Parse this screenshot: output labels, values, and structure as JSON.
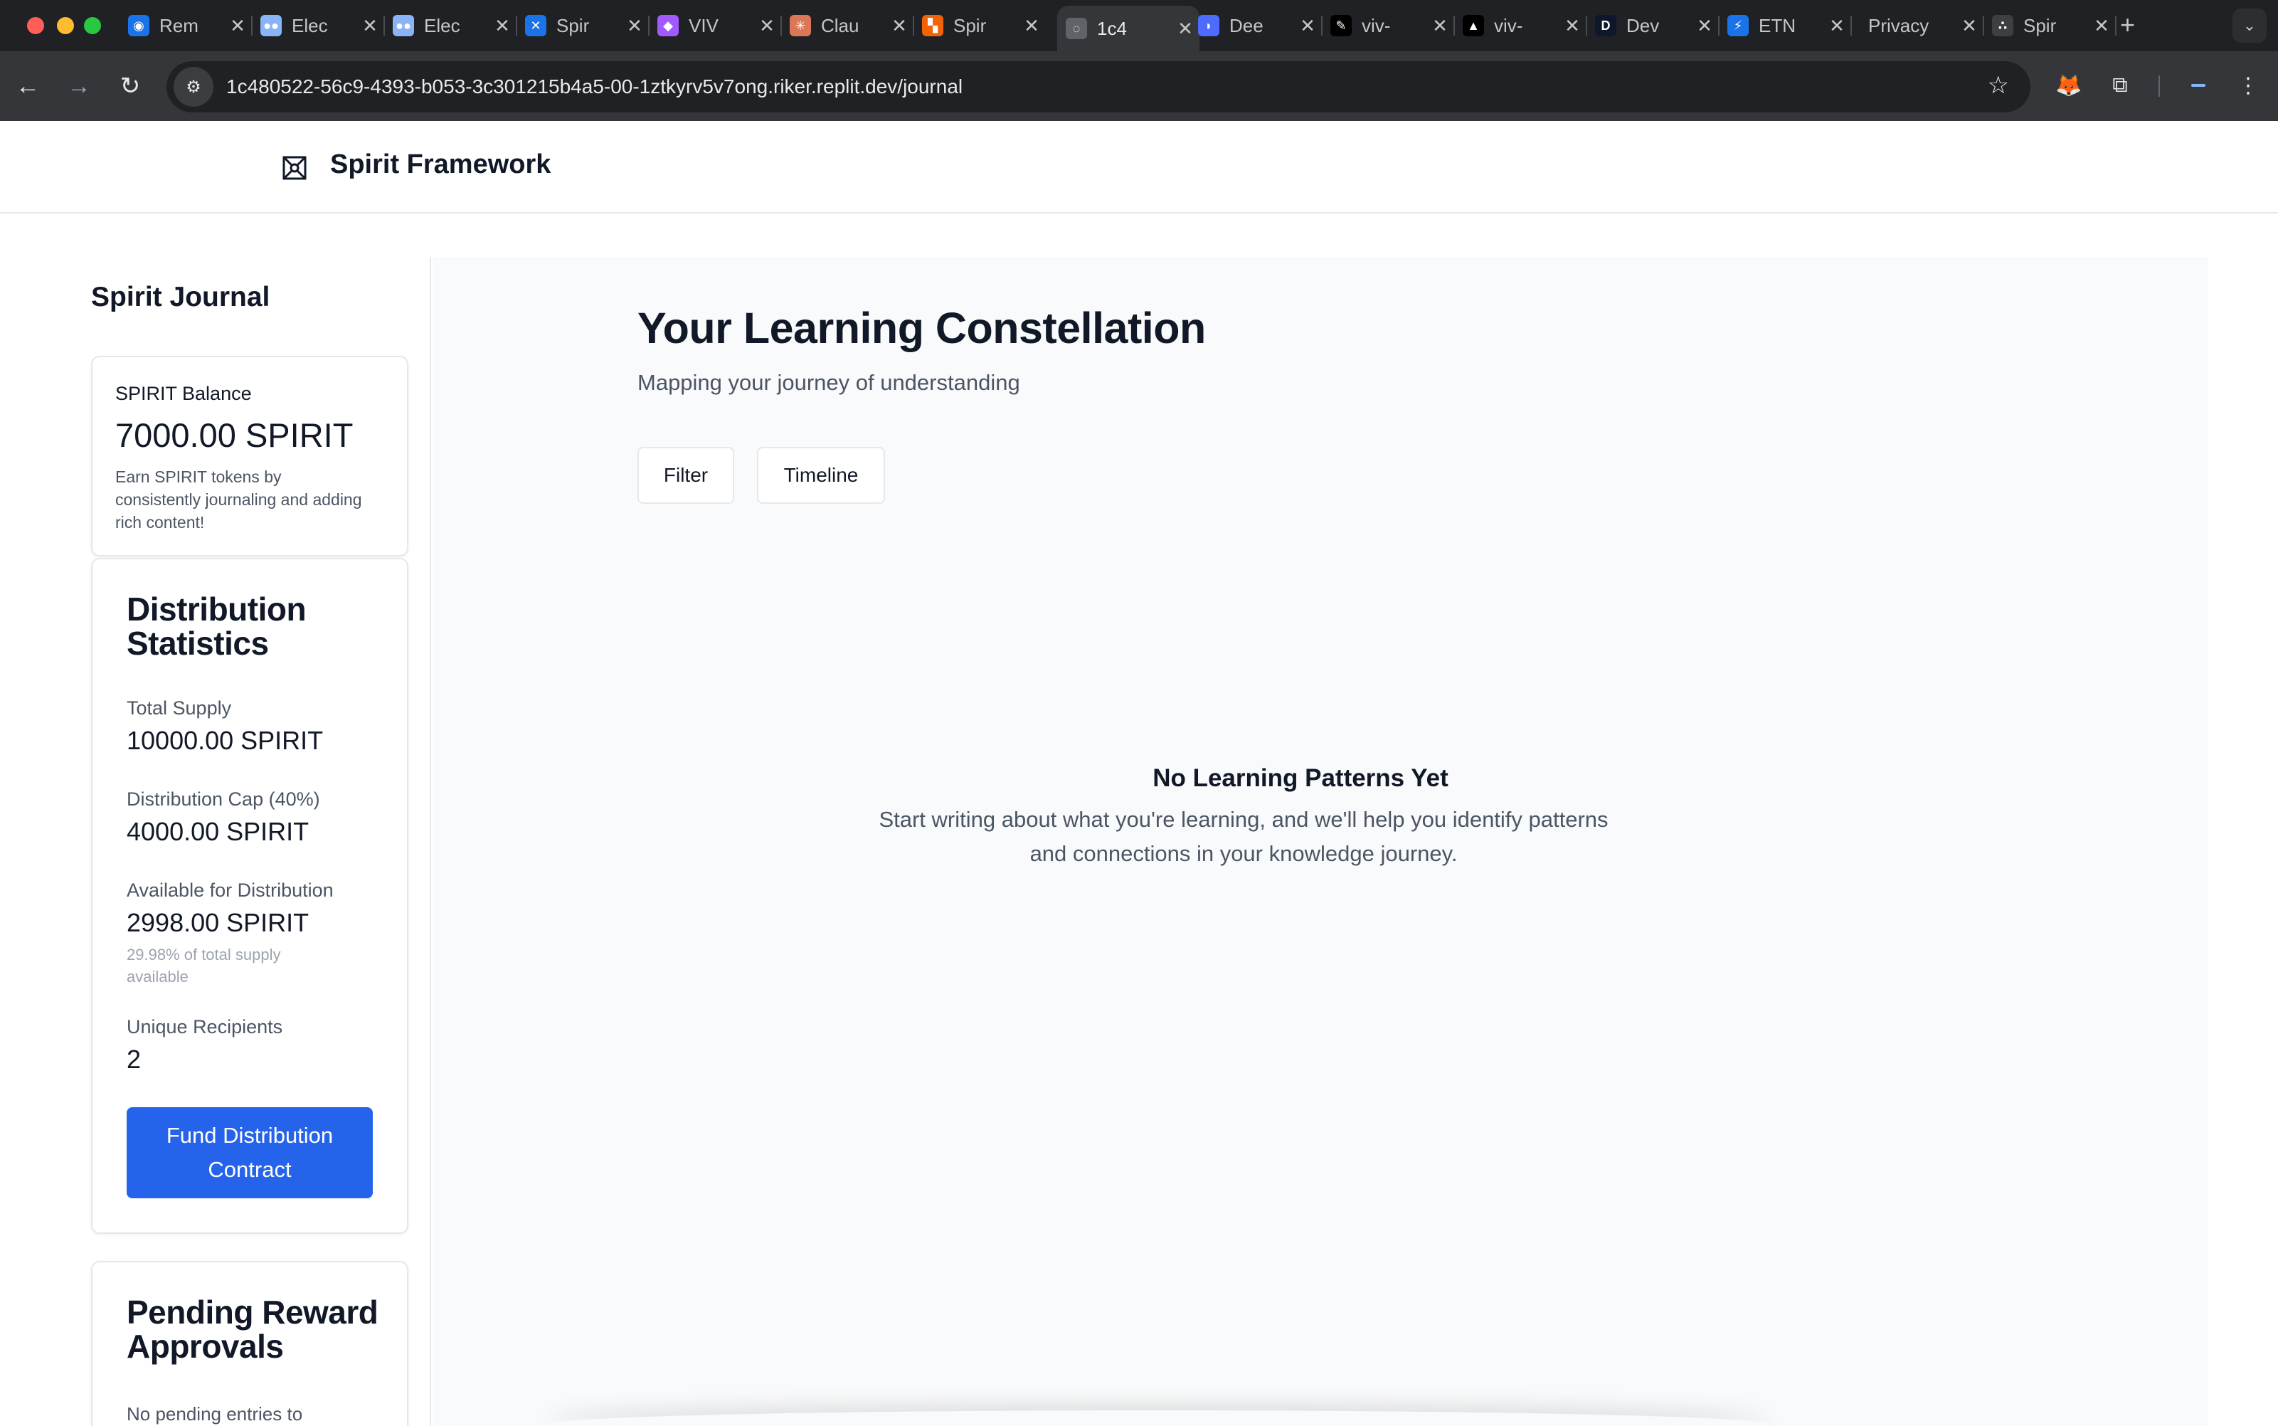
{
  "browser": {
    "tabs": [
      {
        "title": "Rem",
        "icon": "brain-icon",
        "color": "#1a73e8"
      },
      {
        "title": "Elec",
        "icon": "eyes-icon",
        "color": "#8ab4f8"
      },
      {
        "title": "Elec",
        "icon": "eyes-icon",
        "color": "#8ab4f8"
      },
      {
        "title": "Spir",
        "icon": "butterfly-icon",
        "color": "#1a73e8"
      },
      {
        "title": "VIV",
        "icon": "figma-icon",
        "color": "#a259ff"
      },
      {
        "title": "Clau",
        "icon": "claude-icon",
        "color": "#d97757"
      },
      {
        "title": "Spir",
        "icon": "replit-icon",
        "color": "#f26207"
      },
      {
        "title": "1c4",
        "icon": "globe-icon",
        "color": "#5f6368"
      },
      {
        "title": "Dee",
        "icon": "deepseek-icon",
        "color": "#4d6bfe"
      },
      {
        "title": "viv-",
        "icon": "pen-icon",
        "color": "#000000"
      },
      {
        "title": "viv-",
        "icon": "vercel-icon",
        "color": "#000000"
      },
      {
        "title": "Dev",
        "icon": "d-icon",
        "color": "#0f172a"
      },
      {
        "title": "ETN",
        "icon": "bolt-icon",
        "color": "#1a73e8"
      },
      {
        "title": "Privacy",
        "icon": "",
        "color": ""
      },
      {
        "title": "Spir",
        "icon": "spirit-icon",
        "color": "#3c4043"
      }
    ],
    "url": "1c480522-56c9-4393-b053-3c301215b4a5-00-1ztkyrv5v7ong.riker.replit.dev/journal"
  },
  "header": {
    "brand": "Spirit Framework"
  },
  "sidebar": {
    "title": "Spirit Journal",
    "balance": {
      "label": "SPIRIT Balance",
      "amount": "7000.00 SPIRIT",
      "hint": "Earn SPIRIT tokens by consistently journaling and adding rich content!"
    },
    "distribution": {
      "title": "Distribution Statistics",
      "total_supply_label": "Total Supply",
      "total_supply_value": "10000.00 SPIRIT",
      "cap_label": "Distribution Cap (40%)",
      "cap_value": "4000.00 SPIRIT",
      "available_label": "Available for Distribution",
      "available_value": "2998.00 SPIRIT",
      "available_note": "29.98% of total supply available",
      "recipients_label": "Unique Recipients",
      "recipients_value": "2",
      "fund_button": "Fund Distribution Contract"
    },
    "pending": {
      "title": "Pending Reward Approvals",
      "empty": "No pending entries to"
    }
  },
  "main": {
    "title": "Your Learning Constellation",
    "subtitle": "Mapping your journey of understanding",
    "filter_button": "Filter",
    "timeline_button": "Timeline",
    "empty_title": "No Learning Patterns Yet",
    "empty_desc": "Start writing about what you're learning, and we'll help you identify patterns and connections in your knowledge journey."
  },
  "colors": {
    "accent": "#2563eb",
    "main_bg": "#f9fafb"
  }
}
